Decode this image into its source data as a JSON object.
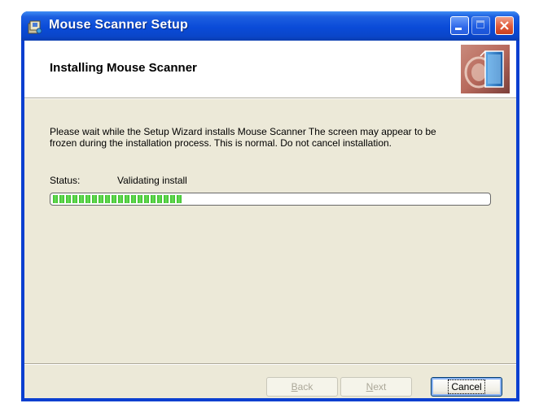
{
  "window": {
    "title": "Mouse Scanner Setup"
  },
  "banner": {
    "title": "Installing Mouse Scanner"
  },
  "body": {
    "description": "Please wait while the Setup Wizard installs Mouse Scanner The screen may appear to be frozen during the installation process. This is normal. Do not cancel installation.",
    "status_label": "Status:",
    "status_value": "Validating install",
    "progress_fraction": 0.3
  },
  "buttons": {
    "back_first": "B",
    "back_rest": "ack",
    "next_first": "N",
    "next_rest": "ext",
    "cancel": "Cancel"
  },
  "icons": {
    "app": "setup-package-icon",
    "banner": "installer-disk-icon",
    "minimize": "minimize-icon",
    "maximize": "maximize-icon",
    "close": "close-icon"
  },
  "colors": {
    "titlebar": "#0a4bd8",
    "dialog_bg": "#ece9d8",
    "progress": "#38c028",
    "close_button": "#e05a3a"
  }
}
